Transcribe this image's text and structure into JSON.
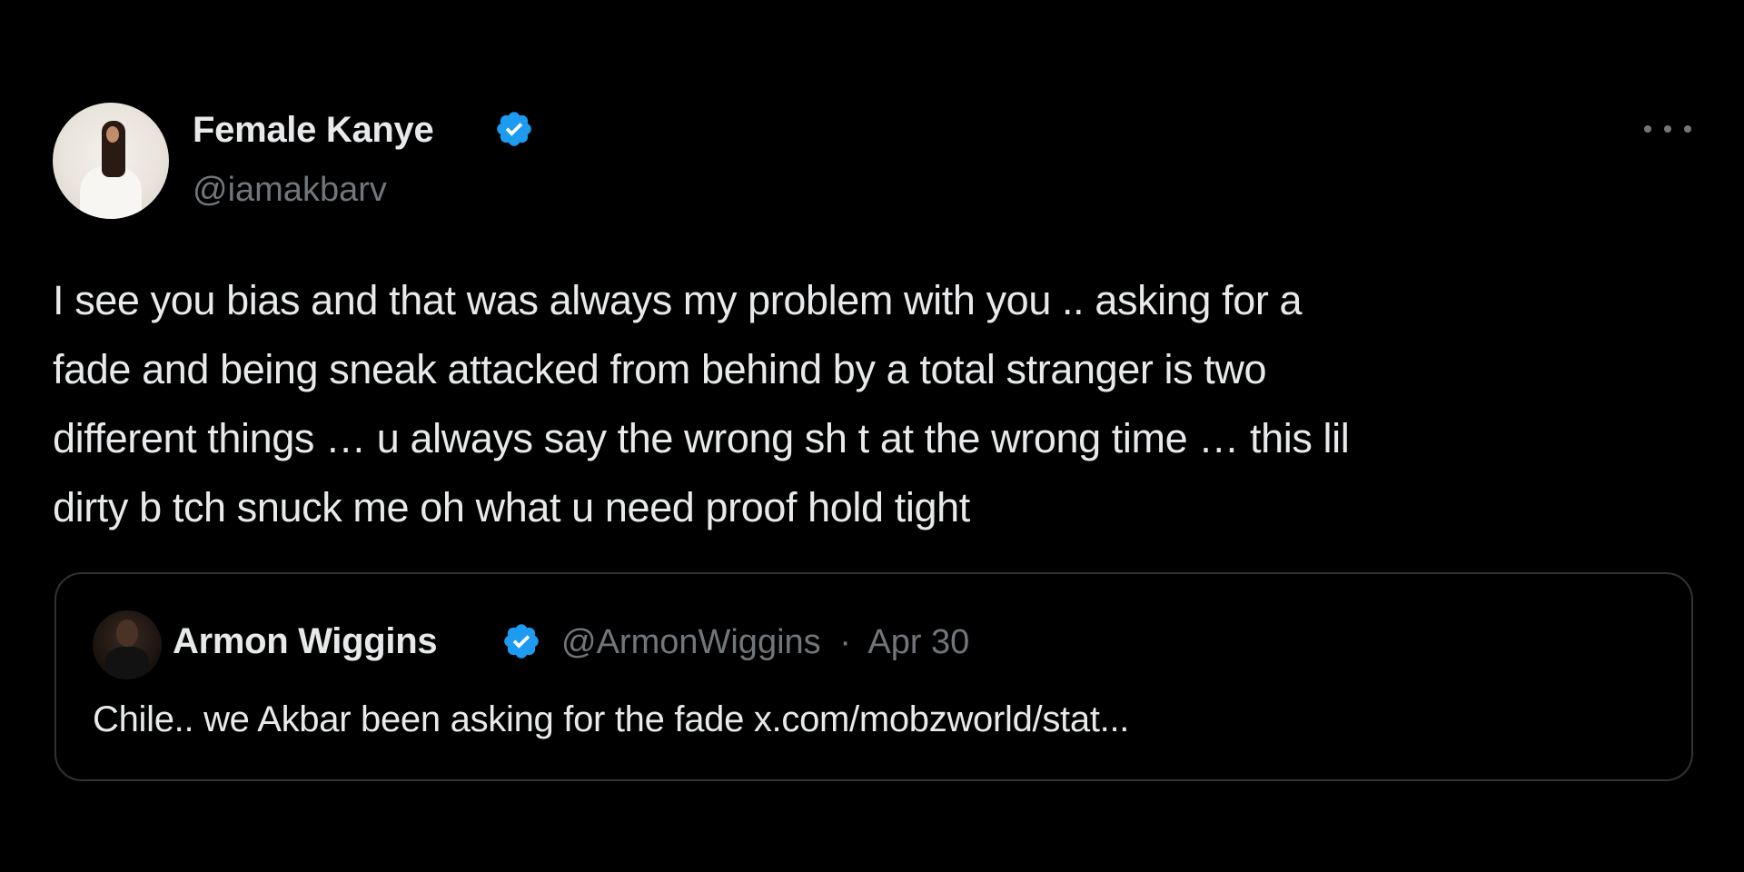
{
  "tweet": {
    "author": {
      "display_name": "Female Kanye",
      "handle": "@iamakbarv",
      "verified_icon": "verified-badge-icon"
    },
    "text_lines": [
      "I see you bias and that was always my problem with you .. asking for a",
      "fade and being sneak attacked from behind by a total stranger is two",
      "different things … u always say the wrong sh t at the wrong time … this lil",
      "dirty b tch snuck me oh what u need proof hold tight"
    ],
    "more_icon": "more-options-icon"
  },
  "quote": {
    "author": {
      "display_name": "Armon Wiggins",
      "handle": "@ArmonWiggins",
      "separator": "·",
      "date": "Apr 30",
      "verified_icon": "verified-badge-icon"
    },
    "text": "Chile.. we Akbar been asking for the fade x.com/mobzworld/stat..."
  },
  "colors": {
    "background": "#000000",
    "primary_text": "#e7e9ea",
    "secondary_text": "#71767b",
    "verified_blue": "#1d9bf0",
    "border": "#2f3336"
  }
}
